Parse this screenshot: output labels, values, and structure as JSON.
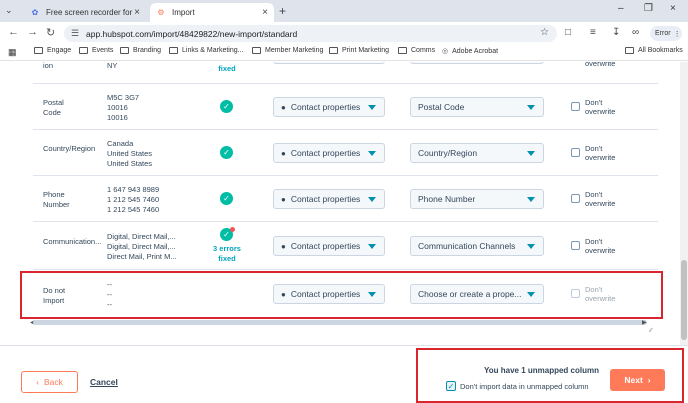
{
  "browser": {
    "tabs": [
      {
        "title": "Free screen recorder for Mac an",
        "icon": "app-icon"
      },
      {
        "title": "Import",
        "icon": "hubspot-icon"
      }
    ],
    "url": "app.hubspot.com/import/48429822/new-import/standard",
    "profile_label": "Error",
    "bookmarks": [
      "Engage",
      "Events",
      "Branding",
      "Links & Marketing...",
      "Member Marketing",
      "Print Marketing",
      "Comms",
      "Adobe Acrobat",
      "All Bookmarks"
    ]
  },
  "table": {
    "partial_top": {
      "name": "ion",
      "sample": "NY",
      "status": "fixed",
      "overwrite": "overwrite"
    },
    "rows": [
      {
        "name": "Postal Code",
        "samples": [
          "M5C 3G7",
          "10016",
          "10016"
        ],
        "status": "ok",
        "object": "Contact properties",
        "field": "Postal Code",
        "overwrite": "Don't overwrite"
      },
      {
        "name": "Country/Region",
        "samples": [
          "Canada",
          "United States",
          "United States"
        ],
        "status": "ok",
        "object": "Contact properties",
        "field": "Country/Region",
        "overwrite": "Don't overwrite"
      },
      {
        "name": "Phone Number",
        "samples": [
          "1 647 943 8989",
          "1 212 545 7460",
          "1 212 545 7460"
        ],
        "status": "ok",
        "object": "Contact properties",
        "field": "Phone Number",
        "overwrite": "Don't overwrite"
      },
      {
        "name": "Communication...",
        "samples": [
          "Digital, Direct Mail,...",
          "Digital, Direct Mail,...",
          "Direct Mail, Print M..."
        ],
        "status": "3 errors fixed",
        "object": "Contact properties",
        "field": "Communication Channels",
        "overwrite": "Don't overwrite"
      },
      {
        "name": "Do not Import",
        "samples": [
          "--",
          "--",
          "--"
        ],
        "status": "",
        "object": "Contact properties",
        "field": "Choose or create a prope...",
        "overwrite": "Don't overwrite"
      }
    ]
  },
  "footer": {
    "back_label": "Back",
    "cancel_label": "Cancel",
    "unmapped_message": "You have 1 unmapped column",
    "ignore_label": "Don't import data in unmapped column",
    "next_label": "Next"
  }
}
